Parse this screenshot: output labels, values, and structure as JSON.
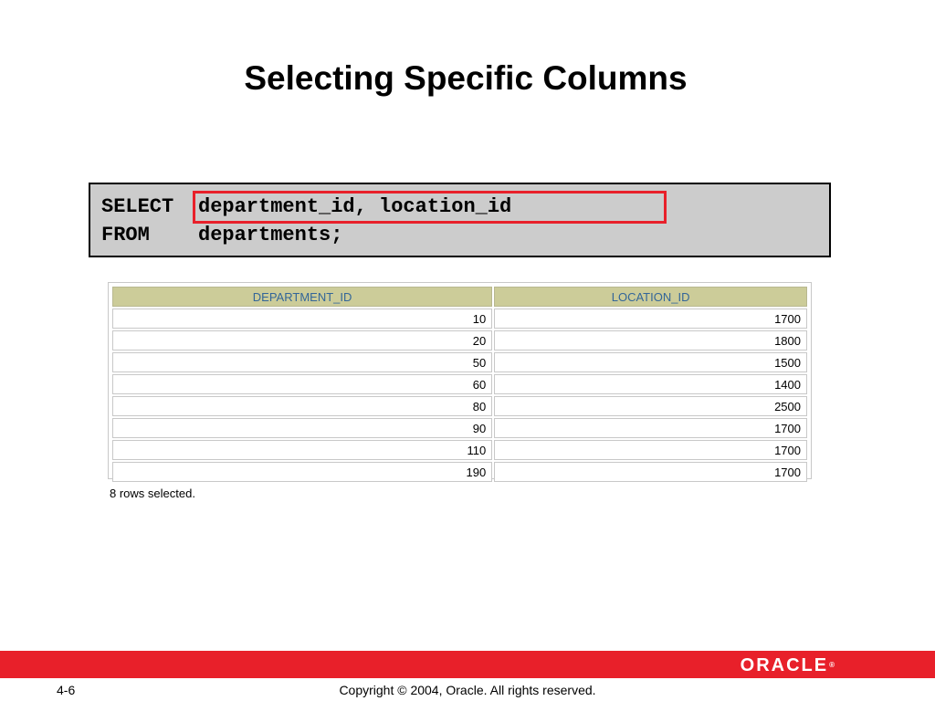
{
  "slide": {
    "title": "Selecting Specific Columns"
  },
  "sql": {
    "line1_keyword": "SELECT",
    "line1_rest": "department_id, location_id",
    "line2_keyword": "FROM",
    "line2_rest": "departments;",
    "highlight_color": "#e8202a",
    "box_color": "#cccccc"
  },
  "results": {
    "columns": [
      "DEPARTMENT_ID",
      "LOCATION_ID"
    ],
    "rows": [
      [
        "10",
        "1700"
      ],
      [
        "20",
        "1800"
      ],
      [
        "50",
        "1500"
      ],
      [
        "60",
        "1400"
      ],
      [
        "80",
        "2500"
      ],
      [
        "90",
        "1700"
      ],
      [
        "110",
        "1700"
      ],
      [
        "190",
        "1700"
      ]
    ],
    "header_bg": "#cccc99",
    "header_text_color": "#336699",
    "note": "8 rows selected."
  },
  "footer": {
    "brand": "ORACLE",
    "brand_mark": "®",
    "bar_color": "#e8202a",
    "page_number": "4-6",
    "copyright": "Copyright © 2004, Oracle.  All rights reserved."
  }
}
